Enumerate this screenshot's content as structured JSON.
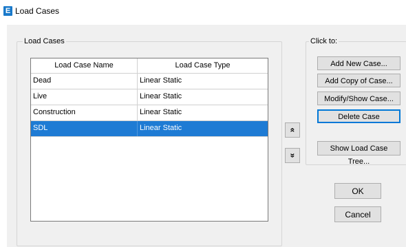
{
  "window": {
    "title": "Load Cases",
    "app_icon_letter": "E"
  },
  "load_cases_group": {
    "label": "Load Cases"
  },
  "table": {
    "columns": [
      "Load Case Name",
      "Load Case Type"
    ],
    "rows": [
      {
        "name": "Dead",
        "type": "Linear Static"
      },
      {
        "name": "Live",
        "type": "Linear Static"
      },
      {
        "name": "Construction",
        "type": "Linear Static"
      },
      {
        "name": "SDL",
        "type": "Linear Static",
        "selected": true
      }
    ]
  },
  "move_buttons": {
    "up": "«",
    "down": "»"
  },
  "click_to_group": {
    "label": "Click to:",
    "buttons": [
      "Add New Case...",
      "Add Copy of Case...",
      "Modify/Show Case...",
      "Delete Case"
    ]
  },
  "show_tree_button": "Show Load Case Tree...",
  "dialog_buttons": {
    "ok": "OK",
    "cancel": "Cancel"
  },
  "colors": {
    "selection": "#1e7bd4",
    "focus_border": "#0078d7",
    "app_icon": "#1979ca"
  }
}
